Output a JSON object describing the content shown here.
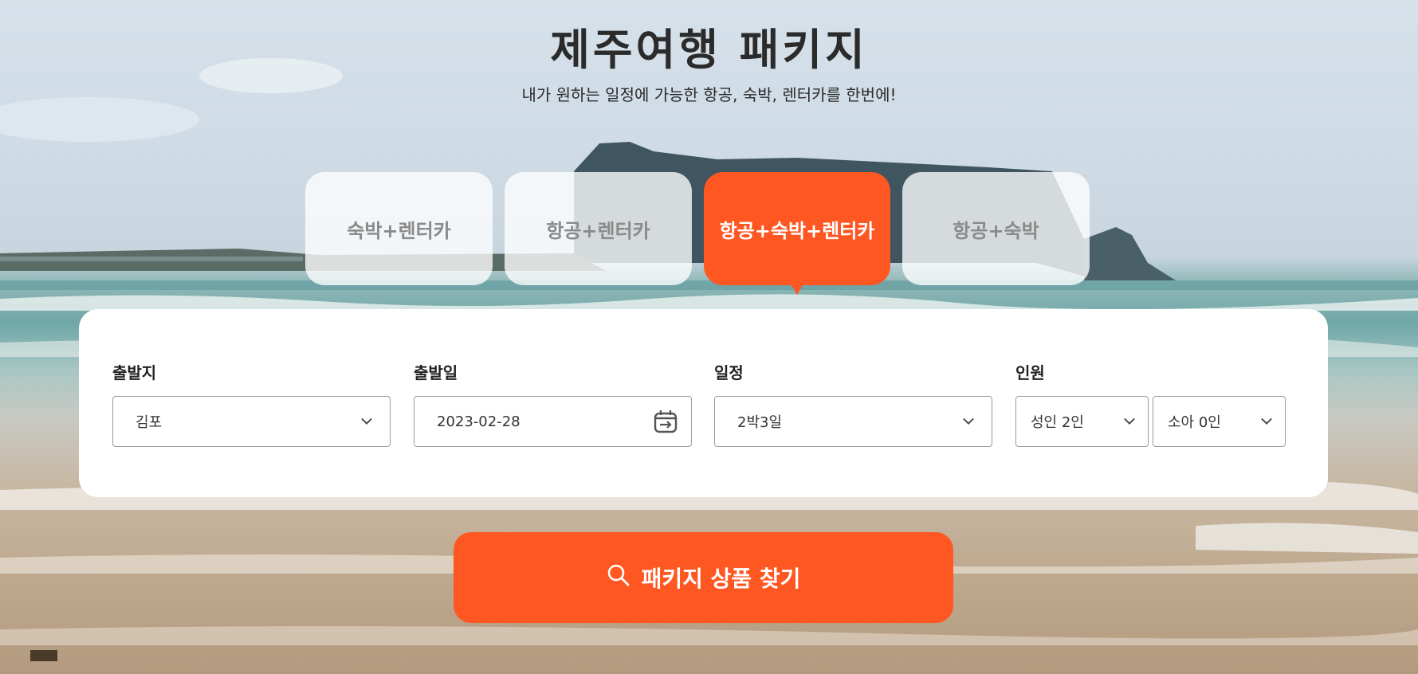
{
  "hero": {
    "title": "제주여행 패키지",
    "subtitle": "내가 원하는 일정에 가능한 항공, 숙박, 렌터카를 한번에!"
  },
  "tabs": [
    {
      "label": "숙박+렌터카",
      "active": false
    },
    {
      "label": "항공+렌터카",
      "active": false
    },
    {
      "label": "항공+숙박+렌터카",
      "active": true
    },
    {
      "label": "항공+숙박",
      "active": false
    }
  ],
  "form": {
    "departure": {
      "label": "출발지",
      "value": "김포"
    },
    "departure_date": {
      "label": "출발일",
      "value": "2023-02-28"
    },
    "schedule": {
      "label": "일정",
      "value": "2박3일"
    },
    "people": {
      "label": "인원",
      "adult": "성인 2인",
      "child": "소아 0인"
    }
  },
  "search_button": {
    "label": "패키지 상품 찾기",
    "icon": "search-icon"
  },
  "colors": {
    "accent": "#ff5722",
    "panel": "#ffffff",
    "title_text": "#2b2b2b"
  }
}
